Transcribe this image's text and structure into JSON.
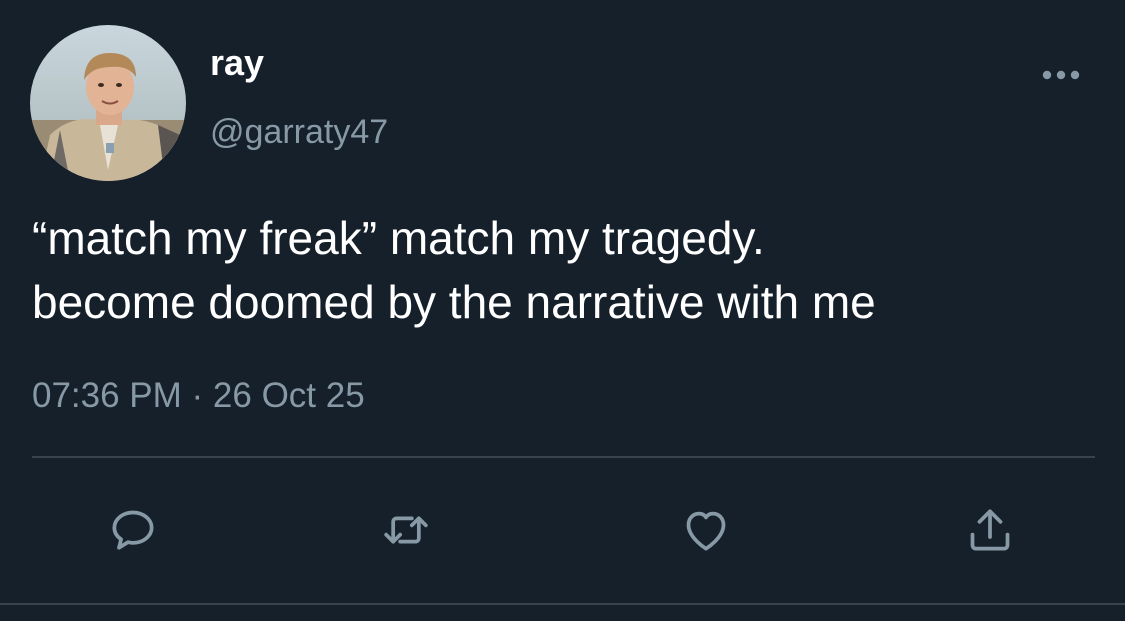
{
  "tweet": {
    "author": {
      "display_name": "ray",
      "handle": "@garraty47",
      "avatar_icon": "profile-photo"
    },
    "text_lines": [
      "“match my freak” match my tragedy.",
      "become doomed by the narrative with me"
    ],
    "timestamp": "07:36 PM · 26 Oct 25"
  },
  "actions": {
    "reply_icon": "speech-bubble-icon",
    "retweet_icon": "retweet-arrows-icon",
    "like_icon": "heart-icon",
    "share_icon": "upload-share-icon",
    "more_icon": "ellipsis-icon"
  },
  "colors": {
    "background": "#15202b",
    "primary_text": "#ffffff",
    "secondary_text": "#8899a6",
    "divider": "#38444d"
  }
}
